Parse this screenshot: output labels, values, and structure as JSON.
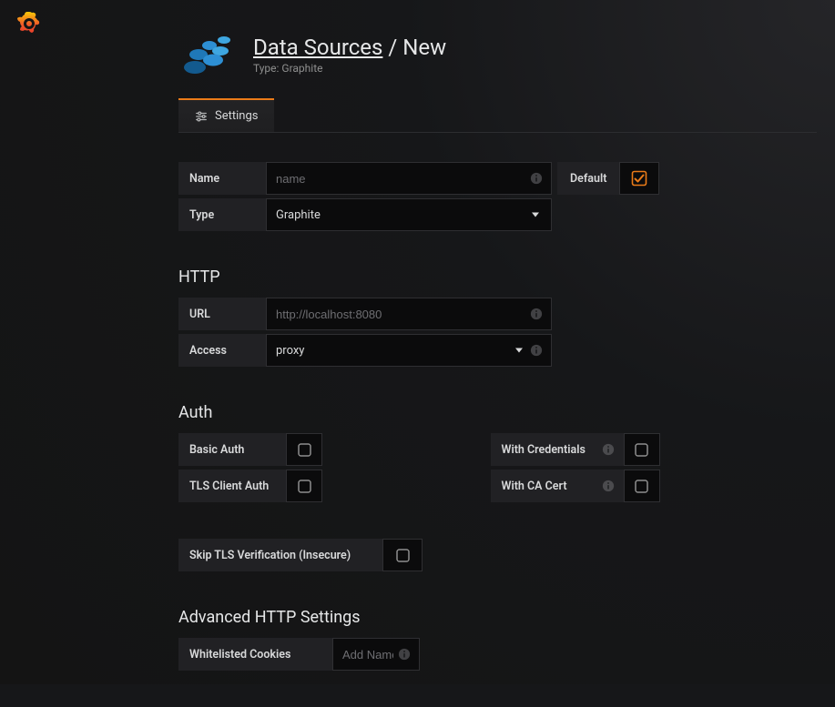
{
  "breadcrumb": {
    "link_label": "Data Sources",
    "separator": " / ",
    "current": "New"
  },
  "subtitle": "Type: Graphite",
  "tabs": {
    "settings_label": "Settings"
  },
  "name_row": {
    "label": "Name",
    "placeholder": "name",
    "value": ""
  },
  "default_toggle": {
    "label": "Default",
    "checked": true
  },
  "type_row": {
    "label": "Type",
    "value": "Graphite"
  },
  "http": {
    "heading": "HTTP",
    "url": {
      "label": "URL",
      "placeholder": "http://localhost:8080",
      "value": ""
    },
    "access": {
      "label": "Access",
      "value": "proxy"
    }
  },
  "auth": {
    "heading": "Auth",
    "basic_auth": {
      "label": "Basic Auth",
      "checked": false
    },
    "with_credentials": {
      "label": "With Credentials",
      "checked": false
    },
    "tls_client_auth": {
      "label": "TLS Client Auth",
      "checked": false
    },
    "with_ca_cert": {
      "label": "With CA Cert",
      "checked": false
    },
    "skip_tls": {
      "label": "Skip TLS Verification (Insecure)",
      "checked": false
    }
  },
  "advanced": {
    "heading": "Advanced HTTP Settings",
    "whitelisted_cookies": {
      "label": "Whitelisted Cookies",
      "placeholder": "Add Name"
    }
  },
  "colors": {
    "accent": "#eb7b18"
  }
}
